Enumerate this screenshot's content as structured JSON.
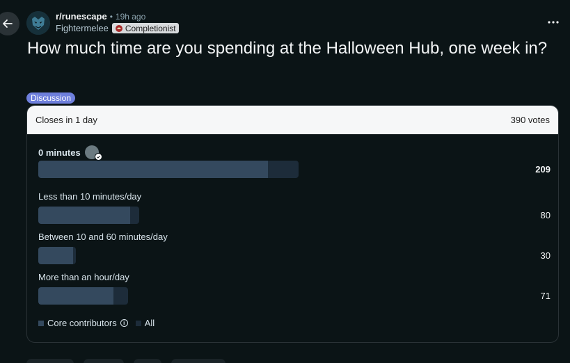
{
  "header": {
    "subreddit": "r/runescape",
    "separator": "•",
    "time": "19h ago",
    "author": "Fightermelee",
    "flair": "Completionist"
  },
  "post": {
    "title": "How much time are you spending at the Halloween Hub, one week in?",
    "tag": "Discussion"
  },
  "poll": {
    "closes": "Closes in 1 day",
    "votes": "390 votes",
    "total_votes": 390,
    "options": [
      {
        "label": "0 minutes",
        "count": "209",
        "all_fraction": 0.508,
        "core_fraction": 0.448,
        "winner": true,
        "voted": true
      },
      {
        "label": "Less than 10 minutes/day",
        "count": "80",
        "all_fraction": 0.197,
        "core_fraction": 0.18,
        "winner": false,
        "voted": false
      },
      {
        "label": "Between 10 and 60 minutes/day",
        "count": "30",
        "all_fraction": 0.074,
        "core_fraction": 0.068,
        "winner": false,
        "voted": false
      },
      {
        "label": "More than an hour/day",
        "count": "71",
        "all_fraction": 0.175,
        "core_fraction": 0.146,
        "winner": false,
        "voted": false
      }
    ],
    "legend": {
      "core": "Core contributors",
      "all": "All"
    }
  },
  "colors": {
    "background": "#0b1416",
    "tag": "#6e7fdc",
    "bar_core": "#34495e",
    "bar_all": "#1d2c3a"
  },
  "icons": [
    "back-arrow-icon",
    "more-options-icon",
    "subreddit-avatar-icon",
    "flair-icon",
    "info-icon",
    "verified-check-icon"
  ]
}
